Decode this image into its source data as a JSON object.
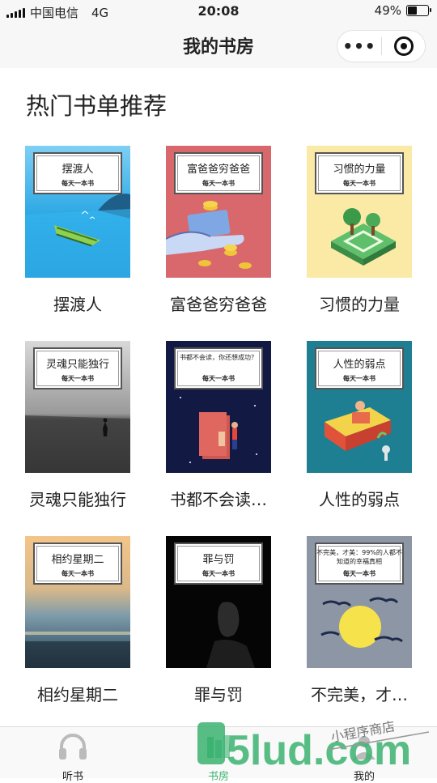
{
  "status": {
    "carrier": "中国电信",
    "network": "4G",
    "time": "20:08",
    "battery": "49%",
    "battery_level": 0.49
  },
  "nav": {
    "title": "我的书房",
    "more_icon": "ellipsis-icon",
    "close_icon": "target-icon"
  },
  "section": {
    "title": "热门书单推荐"
  },
  "books": [
    {
      "title": "摆渡人",
      "cover_title": "摆渡人",
      "cover_sub": "每天一本书"
    },
    {
      "title": "富爸爸穷爸爸",
      "cover_title": "富爸爸穷爸爸",
      "cover_sub": "每天一本书"
    },
    {
      "title": "习惯的力量",
      "cover_title": "习惯的力量",
      "cover_sub": "每天一本书"
    },
    {
      "title": "灵魂只能独行",
      "cover_title": "灵魂只能独行",
      "cover_sub": "每天一本书"
    },
    {
      "title": "书都不会读…",
      "cover_title": "书都不会读，你还想成功？",
      "cover_sub": "每天一本书"
    },
    {
      "title": "人性的弱点",
      "cover_title": "人性的弱点",
      "cover_sub": "每天一本书"
    },
    {
      "title": "相约星期二",
      "cover_title": "相约星期二",
      "cover_sub": "每天一本书"
    },
    {
      "title": "罪与罚",
      "cover_title": "罪与罚",
      "cover_sub": "每天一本书"
    },
    {
      "title": "不完美，才…",
      "cover_title": "不完美，才美：99%的人都不知道的幸福真相",
      "cover_sub": "每天一本书"
    }
  ],
  "tabbar": {
    "items": [
      {
        "label": "听书",
        "icon": "headphones-icon"
      },
      {
        "label": "书房",
        "icon": "bookshelf-icon"
      },
      {
        "label": "我的",
        "icon": "user-icon"
      }
    ]
  },
  "watermark": {
    "brand": "5lud.com",
    "text": "小程序商店"
  },
  "colors": {
    "accent": "#3cb371",
    "text": "#222222",
    "bar_bg": "#f7f7f7"
  }
}
